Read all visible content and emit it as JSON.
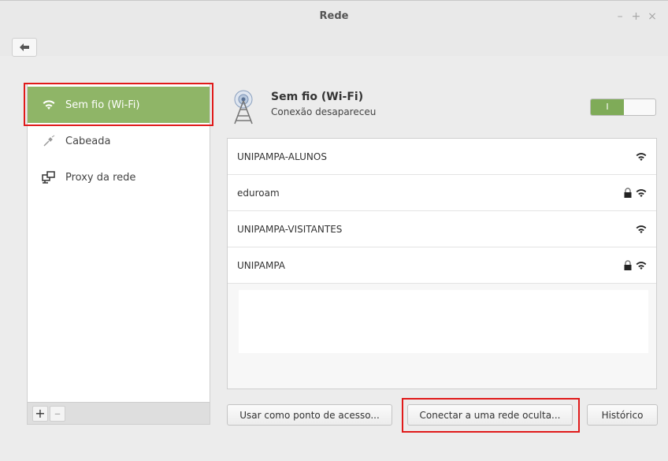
{
  "window": {
    "title": "Rede",
    "controls": [
      "–",
      "+",
      "×"
    ]
  },
  "sidebar": {
    "items": [
      {
        "label": "Sem fio (Wi-Fi)",
        "icon": "wifi-icon",
        "active": true
      },
      {
        "label": "Cabeada",
        "icon": "ethernet-icon",
        "active": false
      },
      {
        "label": "Proxy da rede",
        "icon": "network-proxy-icon",
        "active": false
      }
    ],
    "add_label": "+",
    "remove_label": "–"
  },
  "panel": {
    "title": "Sem fio (Wi-Fi)",
    "subtitle": "Conexão desapareceu",
    "toggle_label": "I",
    "toggle_on": true
  },
  "networks": [
    {
      "name": "UNIPAMPA-ALUNOS",
      "secured": false
    },
    {
      "name": "eduroam",
      "secured": true
    },
    {
      "name": "UNIPAMPA-VISITANTES",
      "secured": false
    },
    {
      "name": "UNIPAMPA",
      "secured": true
    }
  ],
  "buttons": {
    "hotspot": "Usar como ponto de acesso...",
    "hidden_network": "Conectar a uma rede oculta...",
    "history": "Histórico"
  },
  "colors": {
    "accent": "#8fb567",
    "highlight": "#e01a1a"
  }
}
